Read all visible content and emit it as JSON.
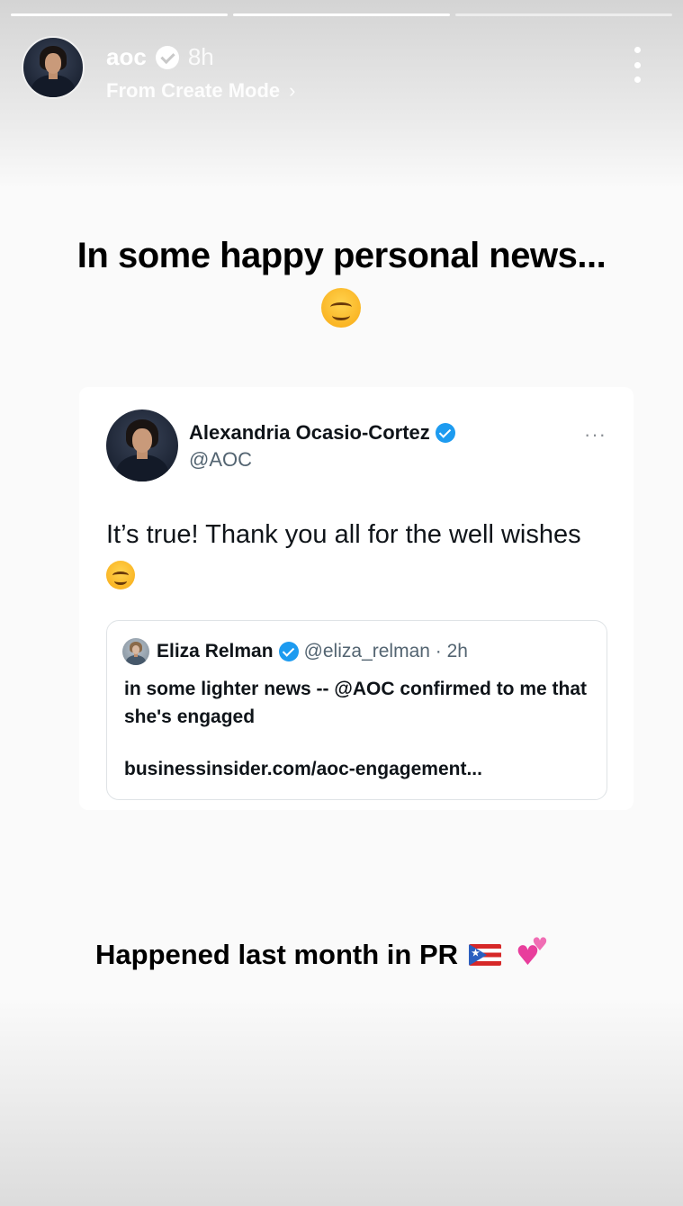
{
  "story": {
    "progress": [
      {
        "name": "segment-1",
        "fill": 1.0
      },
      {
        "name": "segment-2",
        "fill": 1.0
      },
      {
        "name": "segment-3",
        "fill": 0.0
      }
    ],
    "username": "aoc",
    "time_ago": "8h",
    "subtitle": "From Create Mode",
    "subtitle_chevron": "›",
    "more_icon": "more-vertical-icon"
  },
  "content": {
    "headline": "In some happy personal news...",
    "headline_emoji": "smiling-face-icon",
    "caption": "Happened last month in PR",
    "caption_emojis": [
      "puerto-rico-flag-icon",
      "two-hearts-icon"
    ]
  },
  "tweet": {
    "name": "Alexandria Ocasio-Cortez",
    "handle": "@AOC",
    "more": "···",
    "text": "It’s true! Thank you all for the well wishes",
    "quote": {
      "name": "Eliza Relman",
      "meta": "@eliza_relman · 2h",
      "text": "in some lighter news -- @AOC confirmed to me that she's engaged",
      "link": "businessinsider.com/aoc-engagement..."
    }
  },
  "colors": {
    "verified_blue": "#1d9bf0",
    "handle_gray": "#536471",
    "heart_pink": "#e83e9c"
  }
}
